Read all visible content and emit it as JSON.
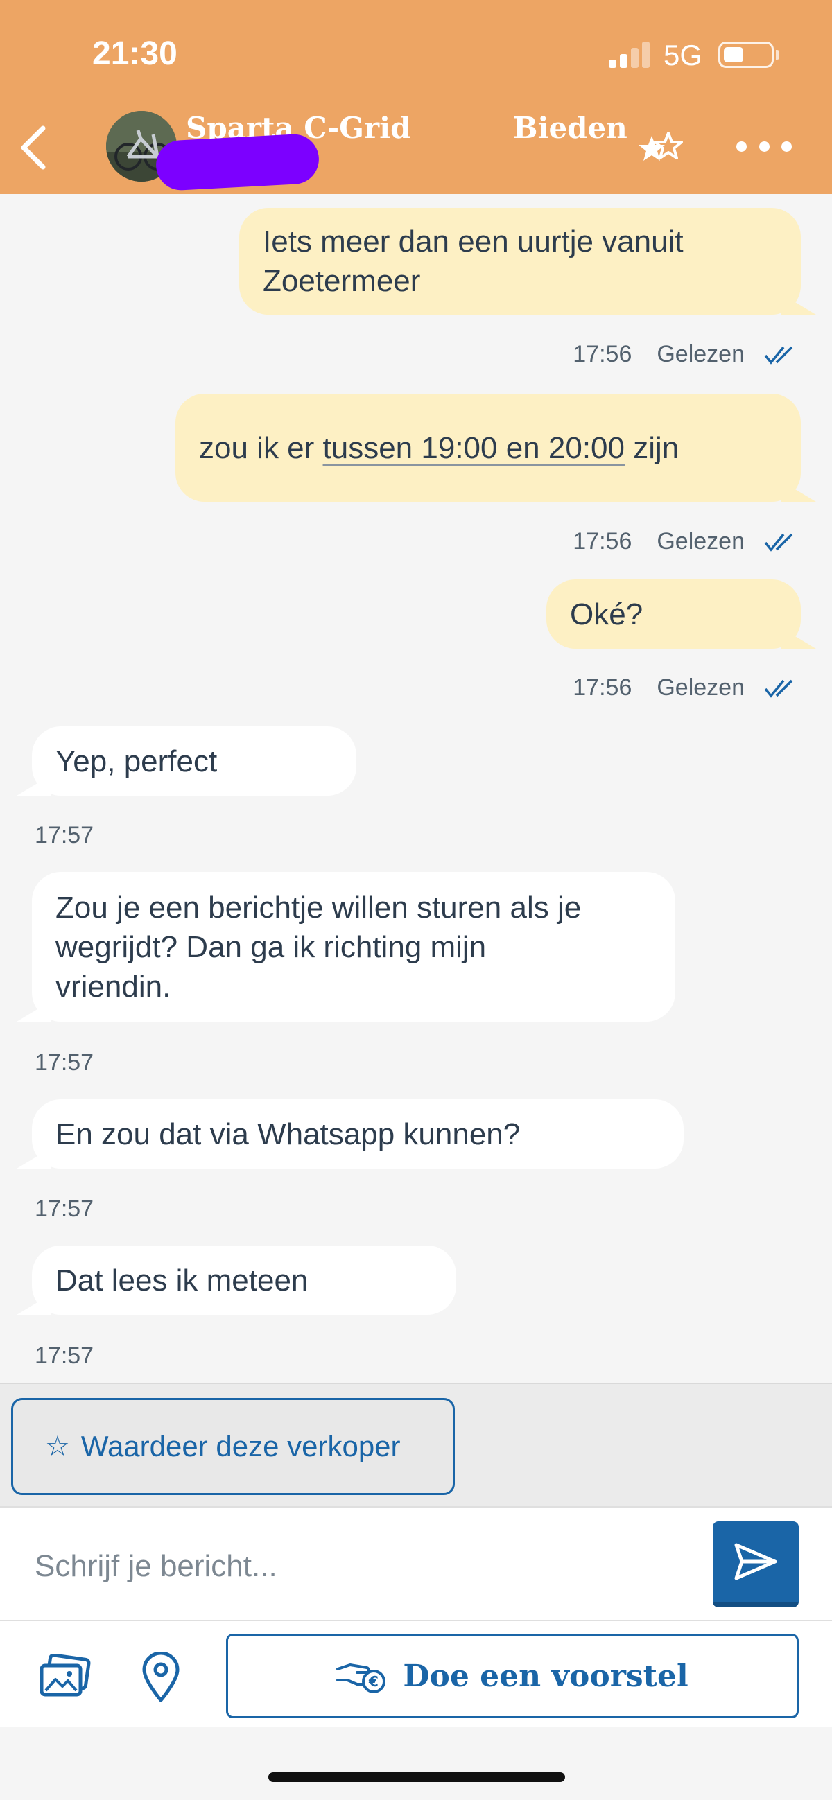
{
  "status_bar": {
    "time": "21:30",
    "network": "5G"
  },
  "header": {
    "title": "Sparta C-Grid",
    "bid_label": "Bieden",
    "background_color": "#eda564"
  },
  "messages": [
    {
      "direction": "out",
      "text": "Iets meer dan een uurtje vanuit Zoetermeer",
      "lines": [
        "Iets meer dan een uurtje vanuit",
        "Zoetermeer"
      ],
      "time": "17:56",
      "status": "Gelezen"
    },
    {
      "direction": "out",
      "text_parts": [
        "zou ik er ",
        "tussen 19:00 en 20:00",
        " zijn"
      ],
      "time": "17:56",
      "status": "Gelezen"
    },
    {
      "direction": "out",
      "text": "Oké?",
      "time": "17:56",
      "status": "Gelezen"
    },
    {
      "direction": "in",
      "text": "Yep, perfect",
      "time": "17:57"
    },
    {
      "direction": "in",
      "text": "Zou je een berichtje willen sturen als je wegrijdt? Dan ga ik richting mijn vriendin.",
      "lines": [
        "Zou je een berichtje willen sturen als je",
        "wegrijdt? Dan ga ik richting mijn",
        "vriendin."
      ],
      "time": "17:57"
    },
    {
      "direction": "in",
      "text": "En zou dat via Whatsapp kunnen?",
      "time": "17:57"
    },
    {
      "direction": "in",
      "text": "Dat lees ik meteen",
      "time": "17:57"
    }
  ],
  "rate_seller": {
    "label": "Waardeer deze verkoper",
    "icon": "star-outline-icon"
  },
  "composer": {
    "placeholder": "Schrijf je bericht...",
    "send_icon": "send-icon"
  },
  "actions": {
    "photo_icon": "photo-gallery-icon",
    "location_icon": "location-pin-icon",
    "proposal_label": "Doe een voorstel",
    "proposal_icon": "hand-coin-icon"
  },
  "colors": {
    "header": "#eda564",
    "outgoing_bubble": "#fdf0c4",
    "incoming_bubble": "#ffffff",
    "accent_blue": "#1a65a7",
    "redaction": "#7c00ff"
  }
}
